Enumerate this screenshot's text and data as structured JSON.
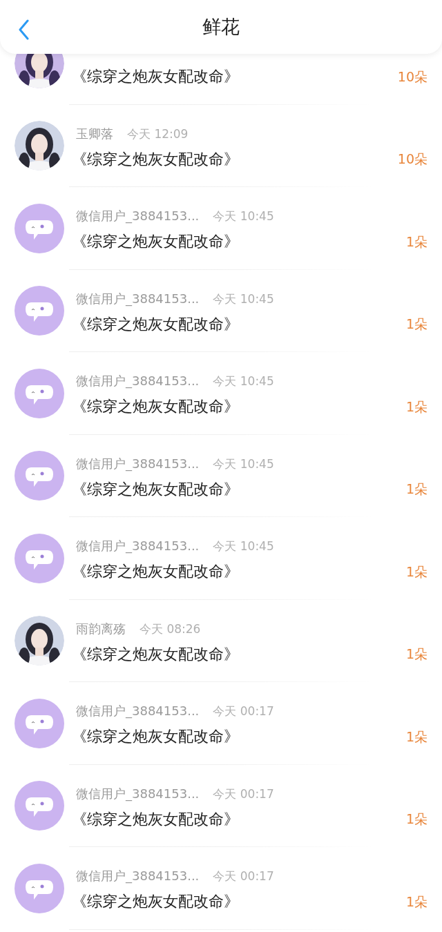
{
  "header": {
    "title": "鲜花"
  },
  "items": [
    {
      "book": "《综穿之炮灰女配改命》",
      "count": "10朵"
    },
    {
      "name": "玉卿落",
      "time": "今天 12:09",
      "book": "《综穿之炮灰女配改命》",
      "count": "10朵"
    },
    {
      "kind": "default",
      "name": "微信用户_3884153...",
      "time": "今天 10:45",
      "book": "《综穿之炮灰女配改命》",
      "count": "1朵"
    },
    {
      "kind": "default",
      "name": "微信用户_3884153...",
      "time": "今天 10:45",
      "book": "《综穿之炮灰女配改命》",
      "count": "1朵"
    },
    {
      "kind": "default",
      "name": "微信用户_3884153...",
      "time": "今天 10:45",
      "book": "《综穿之炮灰女配改命》",
      "count": "1朵"
    },
    {
      "kind": "default",
      "name": "微信用户_3884153...",
      "time": "今天 10:45",
      "book": "《综穿之炮灰女配改命》",
      "count": "1朵"
    },
    {
      "kind": "default",
      "name": "微信用户_3884153...",
      "time": "今天 10:45",
      "book": "《综穿之炮灰女配改命》",
      "count": "1朵"
    },
    {
      "name": "雨韵离殇",
      "time": "今天 08:26",
      "book": "《综穿之炮灰女配改命》",
      "count": "1朵"
    },
    {
      "kind": "default",
      "name": "微信用户_3884153...",
      "time": "今天 00:17",
      "book": "《综穿之炮灰女配改命》",
      "count": "1朵"
    },
    {
      "kind": "default",
      "name": "微信用户_3884153...",
      "time": "今天 00:17",
      "book": "《综穿之炮灰女配改命》",
      "count": "1朵"
    },
    {
      "kind": "default",
      "name": "微信用户_3884153...",
      "time": "今天 00:17",
      "book": "《综穿之炮灰女配改命》",
      "count": "1朵"
    }
  ]
}
